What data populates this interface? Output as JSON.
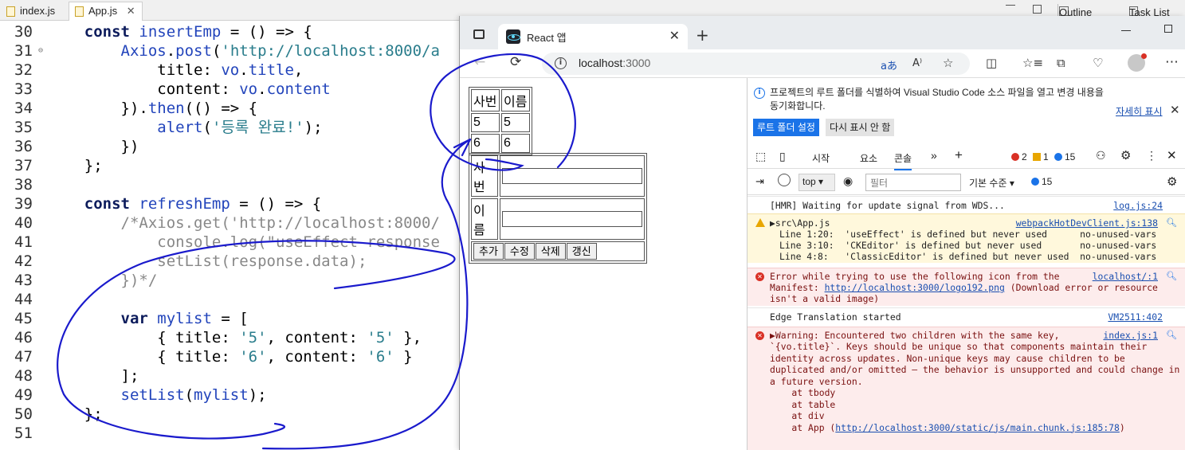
{
  "editor": {
    "tabs": [
      {
        "label": "index.js",
        "active": false
      },
      {
        "label": "App.js",
        "active": true
      }
    ],
    "right_tabs": [
      {
        "label": "Outline"
      },
      {
        "label": "Task List"
      }
    ],
    "lines": [
      {
        "n": "30",
        "html": "    <span class='kw'>const</span> <span class='fn'>insertEmp</span> = () => {"
      },
      {
        "n": "31",
        "fold": true,
        "html": "        <span class='fn'>Axios</span>.<span class='fn'>post</span>(<span class='str'>'http://localhost:8000/a</span>"
      },
      {
        "n": "32",
        "html": "            title: <span class='fn'>vo</span>.<span class='fn'>title</span>,"
      },
      {
        "n": "33",
        "html": "            content: <span class='fn'>vo</span>.<span class='fn'>content</span>"
      },
      {
        "n": "34",
        "html": "        }).<span class='fn'>then</span>(() => {"
      },
      {
        "n": "35",
        "html": "            <span class='fn'>alert</span>(<span class='str'>'등록 완료!'</span>);"
      },
      {
        "n": "36",
        "html": "        })"
      },
      {
        "n": "37",
        "html": "    };"
      },
      {
        "n": "38",
        "html": ""
      },
      {
        "n": "39",
        "html": "    <span class='kw'>const</span> <span class='fn'>refreshEmp</span> = () => {"
      },
      {
        "n": "40",
        "html": "        <span class='cm'>/*Axios.get('http://localhost:8000/</span>"
      },
      {
        "n": "41",
        "html": "            <span class='cm'>console.log(\"useEffect response</span>"
      },
      {
        "n": "42",
        "html": "            <span class='cm'>setList(response.data);</span>"
      },
      {
        "n": "43",
        "html": "        <span class='cm'>})*/</span>"
      },
      {
        "n": "44",
        "html": ""
      },
      {
        "n": "45",
        "html": "        <span class='kw'>var</span> <span class='fn'>mylist</span> = ["
      },
      {
        "n": "46",
        "html": "            { title: <span class='str'>'5'</span>, content: <span class='str'>'5'</span> },"
      },
      {
        "n": "47",
        "html": "            { title: <span class='str'>'6'</span>, content: <span class='str'>'6'</span> }"
      },
      {
        "n": "48",
        "html": "        ];"
      },
      {
        "n": "49",
        "html": "        <span class='fn'>setList</span>(<span class='fn'>mylist</span>);"
      },
      {
        "n": "50",
        "html": "    };"
      },
      {
        "n": "51",
        "html": ""
      }
    ]
  },
  "browser": {
    "tab_title": "React 앱",
    "tab_close": "✕",
    "new_tab": "+",
    "url_host": "localhost",
    "url_port": ":3000",
    "page": {
      "list_headers": [
        "사번",
        "이름"
      ],
      "list_rows": [
        [
          "5",
          "5"
        ],
        [
          "6",
          "6"
        ]
      ],
      "form_labels": [
        "사번",
        "이름"
      ],
      "buttons": [
        "추가",
        "수정",
        "삭제",
        "갱신"
      ]
    },
    "devtools": {
      "notice_text": "프로젝트의 루트 폴더를 식별하여 Visual Studio Code 소스 파일을 열고 변경 내용을 동기화합니다.",
      "notice_link": "자세히 표시",
      "btn_set_root": "루트 폴더 설정",
      "btn_dont_show": "다시 표시 안 함",
      "tabs": [
        "시작",
        "요소",
        "콘솔"
      ],
      "error_count": "2",
      "warning_count": "1",
      "info_count": "15",
      "context": "top",
      "filter_placeholder": "필터",
      "levels_label": "기본 수준",
      "levels_count": "15",
      "messages": [
        {
          "type": "log",
          "text": "[HMR] Waiting for update signal from WDS...",
          "src": "log.js:24"
        },
        {
          "type": "warn",
          "text": "▶src\\App.js",
          "src": "webpackHotDevClient.js:138",
          "sub": [
            "Line 1:20:  'useEffect' is defined but never used      no-unused-vars",
            "Line 3:10:  'CKEditor' is defined but never used       no-unused-vars",
            "Line 4:8:   'ClassicEditor' is defined but never used  no-unused-vars"
          ]
        },
        {
          "type": "err",
          "text": "Error while trying to use the following icon from the",
          "src": "localhost/:1",
          "line2_pre": "Manifest: ",
          "line2_link": "http://localhost:3000/logo192.png",
          "line2_post": " (Download error or resource",
          "line3": "isn't a valid image)"
        },
        {
          "type": "log",
          "text": "Edge Translation started",
          "src": "VM2511:402"
        },
        {
          "type": "err",
          "text": "▶Warning: Encountered two children with the same key,",
          "src": "index.js:1",
          "body": [
            "`{vo.title}`. Keys should be unique so that components maintain their",
            "identity across updates. Non-unique keys may cause children to be",
            "duplicated and/or omitted — the behavior is unsupported and could change in",
            "a future version.",
            "    at tbody",
            "    at table",
            "    at div"
          ],
          "last_pre": "    at App (",
          "last_link": "http://localhost:3000/static/js/main.chunk.js:185:78",
          "last_post": ")"
        }
      ]
    }
  }
}
